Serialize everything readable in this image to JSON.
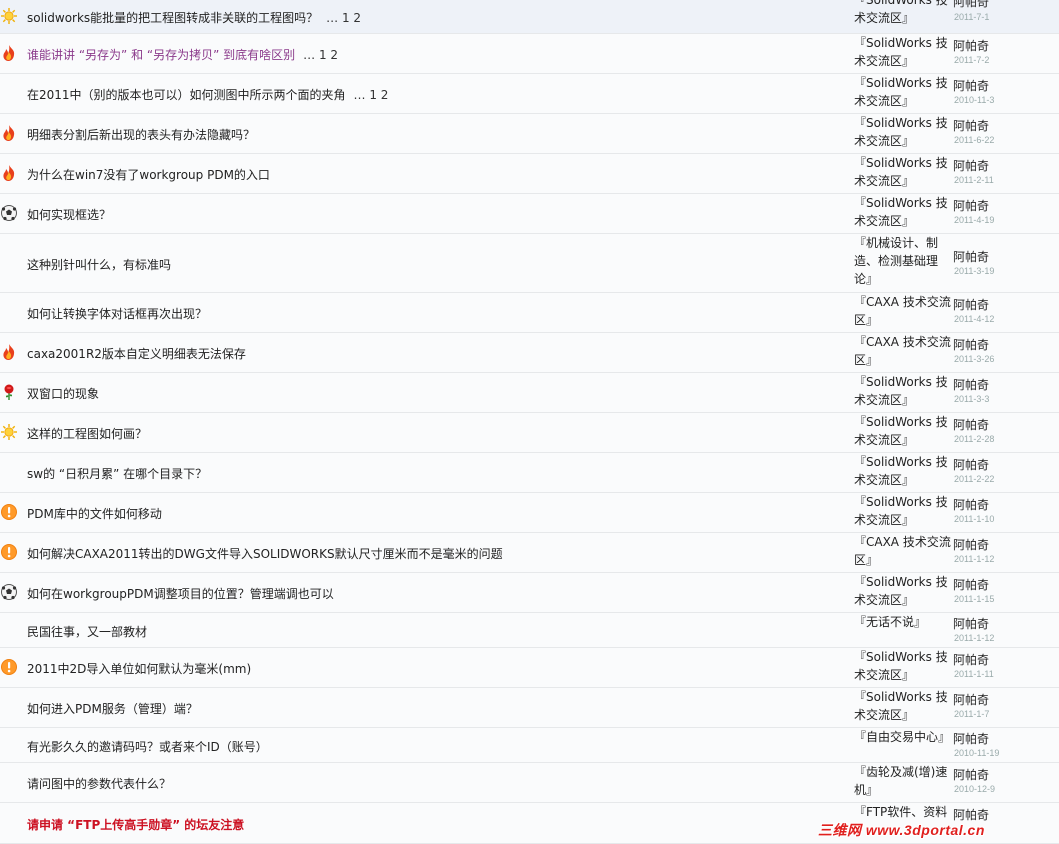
{
  "threads": [
    {
      "icon": "sun-icon",
      "title": "solidworks能批量的把工程图转成非关联的工程图吗？",
      "pages": "… 1 2",
      "style": "normal",
      "forum": "『SolidWorks 技术交流区』",
      "author": "阿帕奇",
      "date": "2011-7-1"
    },
    {
      "icon": "fire-icon",
      "title": "谁能讲讲 “另存为” 和 “另存为拷贝” 到底有啥区别",
      "pages": "… 1 2",
      "style": "visited",
      "forum": "『SolidWorks 技术交流区』",
      "author": "阿帕奇",
      "date": "2011-7-2"
    },
    {
      "icon": "",
      "title": "在2011中（别的版本也可以）如何测图中所示两个面的夹角",
      "pages": "… 1 2",
      "style": "normal",
      "forum": "『SolidWorks 技术交流区』",
      "author": "阿帕奇",
      "date": "2010-11-3"
    },
    {
      "icon": "fire-icon",
      "title": "明细表分割后新出现的表头有办法隐藏吗？",
      "pages": "",
      "style": "normal",
      "forum": "『SolidWorks 技术交流区』",
      "author": "阿帕奇",
      "date": "2011-6-22"
    },
    {
      "icon": "fire-icon",
      "title": "为什么在win7没有了workgroup PDM的入口",
      "pages": "",
      "style": "normal",
      "forum": "『SolidWorks 技术交流区』",
      "author": "阿帕奇",
      "date": "2011-2-11"
    },
    {
      "icon": "soccer-ball-icon",
      "title": "如何实现框选？",
      "pages": "",
      "style": "normal",
      "forum": "『SolidWorks 技术交流区』",
      "author": "阿帕奇",
      "date": "2011-4-19"
    },
    {
      "icon": "",
      "title": "这种别针叫什么，有标准吗",
      "pages": "",
      "style": "normal",
      "forum": "『机械设计、制造、检测基础理论』",
      "author": "阿帕奇",
      "date": "2011-3-19"
    },
    {
      "icon": "",
      "title": "如何让转换字体对话框再次出现？",
      "pages": "",
      "style": "normal",
      "forum": "『CAXA 技术交流区』",
      "author": "阿帕奇",
      "date": "2011-4-12"
    },
    {
      "icon": "fire-icon",
      "title": "caxa2001R2版本自定义明细表无法保存",
      "pages": "",
      "style": "normal",
      "forum": "『CAXA 技术交流区』",
      "author": "阿帕奇",
      "date": "2011-3-26"
    },
    {
      "icon": "rose-icon",
      "title": "双窗口的现象",
      "pages": "",
      "style": "normal",
      "forum": "『SolidWorks 技术交流区』",
      "author": "阿帕奇",
      "date": "2011-3-3"
    },
    {
      "icon": "sun-icon",
      "title": "这样的工程图如何画？",
      "pages": "",
      "style": "normal",
      "forum": "『SolidWorks 技术交流区』",
      "author": "阿帕奇",
      "date": "2011-2-28"
    },
    {
      "icon": "",
      "title": "sw的 “日积月累” 在哪个目录下？",
      "pages": "",
      "style": "normal",
      "forum": "『SolidWorks 技术交流区』",
      "author": "阿帕奇",
      "date": "2011-2-22"
    },
    {
      "icon": "exclamation-icon",
      "title": "PDM库中的文件如何移动",
      "pages": "",
      "style": "normal",
      "forum": "『SolidWorks 技术交流区』",
      "author": "阿帕奇",
      "date": "2011-1-10"
    },
    {
      "icon": "exclamation-icon",
      "title": "如何解决CAXA2011转出的DWG文件导入SOLIDWORKS默认尺寸厘米而不是毫米的问题",
      "pages": "",
      "style": "normal",
      "forum": "『CAXA 技术交流区』",
      "author": "阿帕奇",
      "date": "2011-1-12"
    },
    {
      "icon": "soccer-ball-icon",
      "title": "如何在workgroupPDM调整项目的位置？管理端调也可以",
      "pages": "",
      "style": "normal",
      "forum": "『SolidWorks 技术交流区』",
      "author": "阿帕奇",
      "date": "2011-1-15"
    },
    {
      "icon": "",
      "title": "民国往事，又一部教材",
      "pages": "",
      "style": "normal",
      "forum": "『无话不说』",
      "author": "阿帕奇",
      "date": "2011-1-12"
    },
    {
      "icon": "exclamation-icon",
      "title": "2011中2D导入单位如何默认为毫米(mm)",
      "pages": "",
      "style": "normal",
      "forum": "『SolidWorks 技术交流区』",
      "author": "阿帕奇",
      "date": "2011-1-11"
    },
    {
      "icon": "",
      "title": "如何进入PDM服务（管理）端？",
      "pages": "",
      "style": "normal",
      "forum": "『SolidWorks 技术交流区』",
      "author": "阿帕奇",
      "date": "2011-1-7"
    },
    {
      "icon": "",
      "title": "有光影久久的邀请码吗？或者来个ID（账号）",
      "pages": "",
      "style": "normal",
      "forum": "『自由交易中心』",
      "author": "阿帕奇",
      "date": "2010-11-19"
    },
    {
      "icon": "",
      "title": "请问图中的参数代表什么？",
      "pages": "",
      "style": "normal",
      "forum": "『齿轮及减(增)速机』",
      "author": "阿帕奇",
      "date": "2010-12-9"
    },
    {
      "icon": "",
      "title": "请申请 “FTP上传高手勋章” 的坛友注意",
      "pages": "",
      "style": "red",
      "forum": "『FTP软件、资料",
      "author": "阿帕奇",
      "date": ""
    }
  ],
  "watermark": "三维网 www.3dportal.cn",
  "colors": {
    "row_bg": "#fafbfc",
    "first_row_bg": "#eef2f8",
    "divider": "#e6e8ea",
    "visited": "#8b3a8b",
    "sticky_red": "#cc1122",
    "date_grey": "#9aa"
  }
}
